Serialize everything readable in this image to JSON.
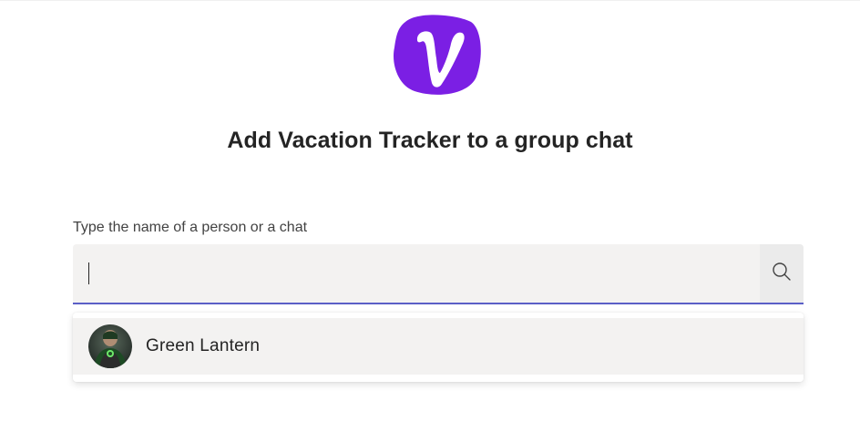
{
  "app": {
    "logo_icon": "vacation-tracker-logo",
    "brand_color": "#7b1fe4"
  },
  "title": "Add Vacation Tracker to a group chat",
  "search": {
    "label": "Type the name of a person or a chat",
    "value": "",
    "placeholder": "",
    "icon": "search-icon",
    "accent_color": "#5b5fc7"
  },
  "results": [
    {
      "name": "Green Lantern",
      "avatar_icon": "avatar"
    }
  ]
}
